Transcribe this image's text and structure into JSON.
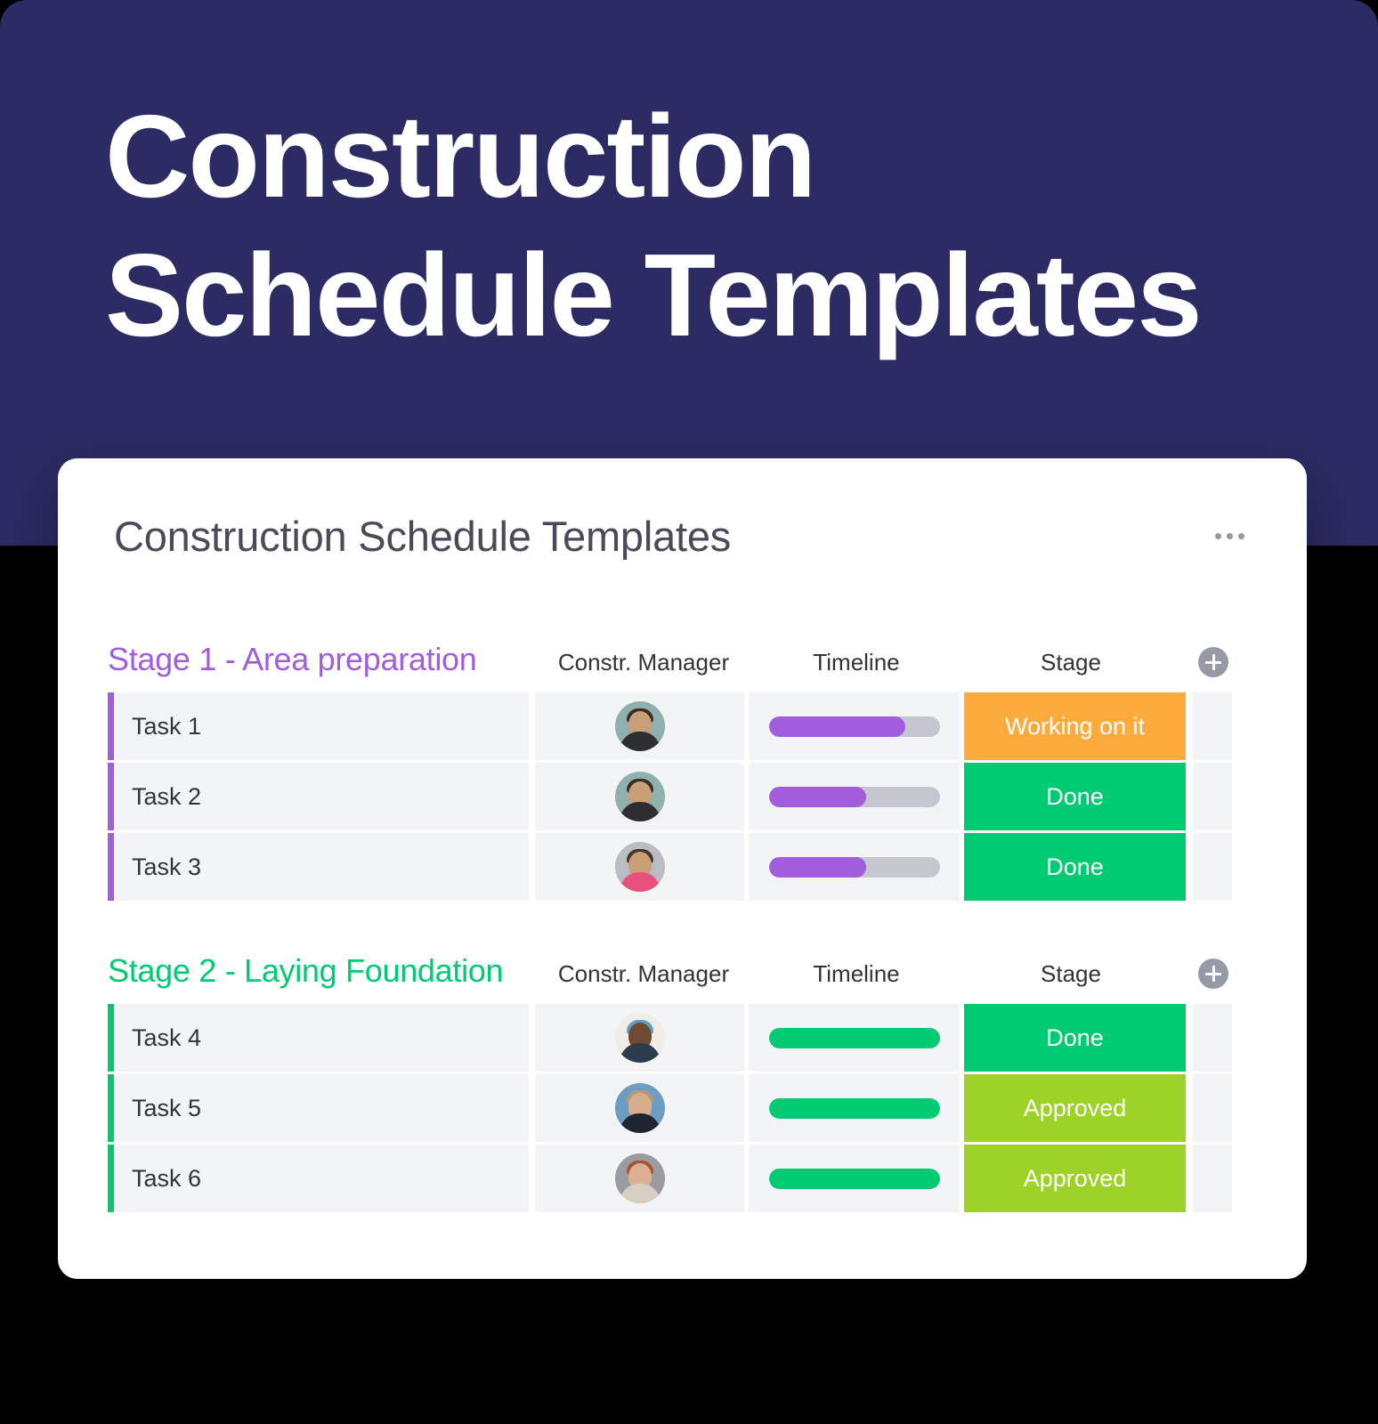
{
  "hero": {
    "title": "Construction\nSchedule Templates",
    "background_color": "#2c2b63"
  },
  "board": {
    "title": "Construction Schedule Templates",
    "menu_icon": "more-horizontal-icon",
    "add_column_icon": "plus-circle-icon",
    "columns": {
      "manager": "Constr. Manager",
      "timeline": "Timeline",
      "stage": "Stage"
    },
    "groups": [
      {
        "title": "Stage 1 - Area preparation",
        "color": "#a25ddc",
        "rows": [
          {
            "name": "Task 1",
            "avatar": "avatar-person-1",
            "timeline_percent": 80,
            "timeline_color": "#a25ddc",
            "stage": "Working on it",
            "stage_color": "#fdab3d"
          },
          {
            "name": "Task 2",
            "avatar": "avatar-person-2",
            "timeline_percent": 57,
            "timeline_color": "#a25ddc",
            "stage": "Done",
            "stage_color": "#00ca72"
          },
          {
            "name": "Task 3",
            "avatar": "avatar-person-3",
            "timeline_percent": 57,
            "timeline_color": "#a25ddc",
            "stage": "Done",
            "stage_color": "#00ca72"
          }
        ]
      },
      {
        "title": "Stage 2 - Laying Foundation",
        "color": "#00ca72",
        "rows": [
          {
            "name": "Task 4",
            "avatar": "avatar-person-4",
            "timeline_percent": 100,
            "timeline_color": "#00ca72",
            "stage": "Done",
            "stage_color": "#00ca72"
          },
          {
            "name": "Task 5",
            "avatar": "avatar-person-5",
            "timeline_percent": 100,
            "timeline_color": "#00ca72",
            "stage": "Approved",
            "stage_color": "#9cd326"
          },
          {
            "name": "Task 6",
            "avatar": "avatar-person-6",
            "timeline_percent": 100,
            "timeline_color": "#00ca72",
            "stage": "Approved",
            "stage_color": "#9cd326"
          }
        ]
      }
    ]
  },
  "avatar_styles": {
    "avatar-person-1": {
      "bg": "#8fb0ae",
      "hair": "#3a2d23",
      "body": "#2e2e30",
      "skin": "#c99f78"
    },
    "avatar-person-2": {
      "bg": "#8fb0ae",
      "hair": "#3a2d23",
      "body": "#2e2e30",
      "skin": "#c99f78"
    },
    "avatar-person-3": {
      "bg": "#b9bcc2",
      "hair": "#4a3626",
      "body": "#e8517a",
      "skin": "#c99f78"
    },
    "avatar-person-4": {
      "bg": "#f0ece6",
      "hair": "#5f9ec4",
      "body": "#2d3b4e",
      "skin": "#6e4a33"
    },
    "avatar-person-5": {
      "bg": "#6e9dc4",
      "hair": "#b79a73",
      "body": "#1f2430",
      "skin": "#d6ae8b"
    },
    "avatar-person-6": {
      "bg": "#9a9ca3",
      "hair": "#a8542a",
      "body": "#d8cfc2",
      "skin": "#dcb193"
    }
  }
}
